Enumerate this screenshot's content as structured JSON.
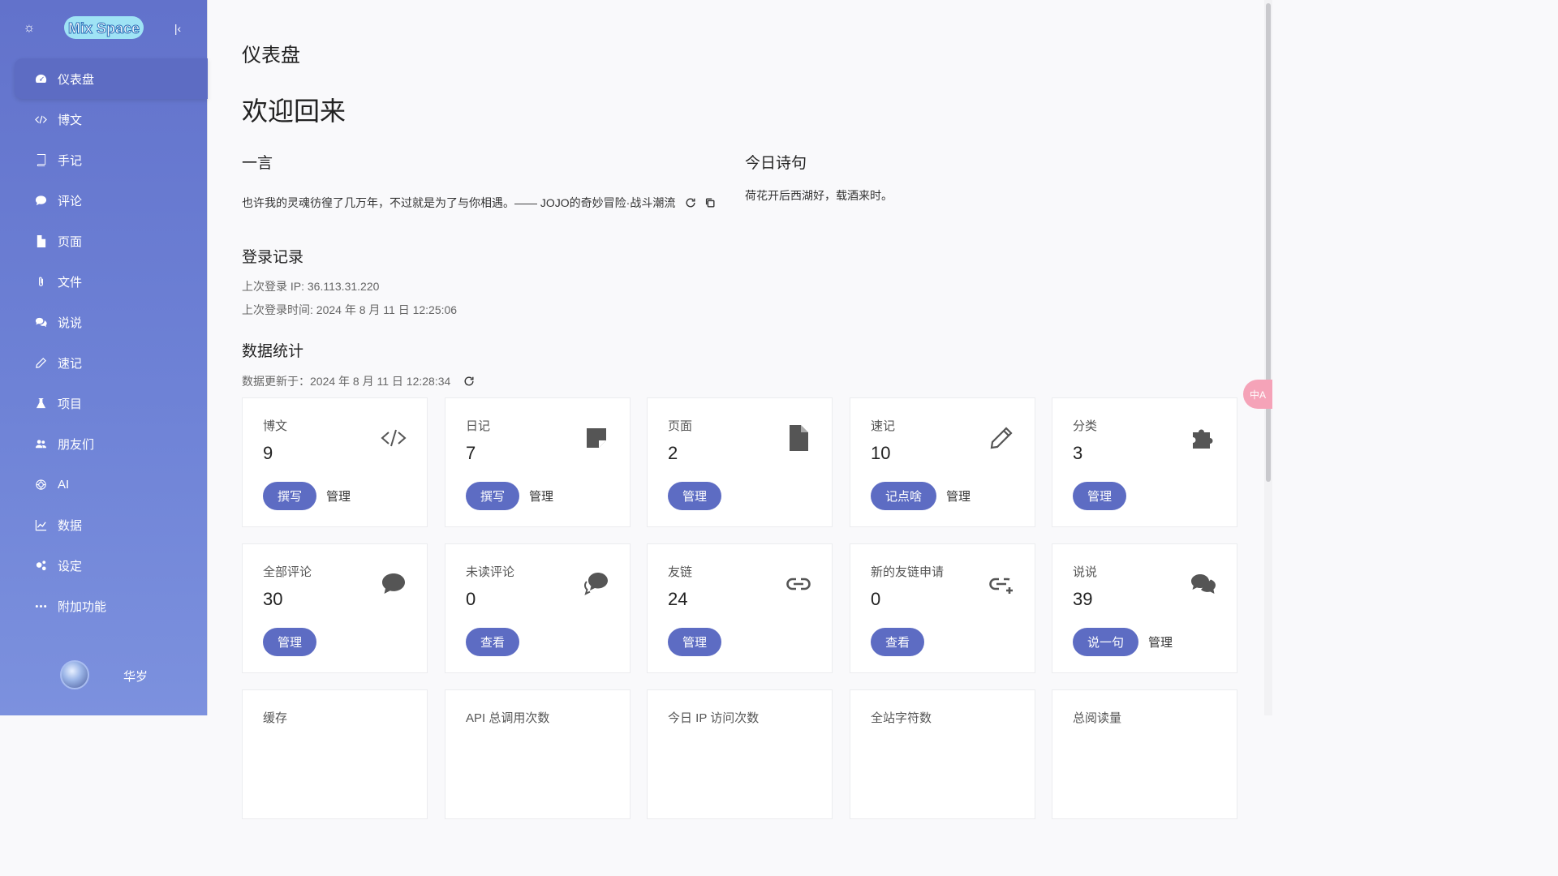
{
  "sidebar": {
    "logo_text": "Mix Space",
    "nav": [
      {
        "label": "仪表盘",
        "icon": "dashboard-icon",
        "active": true
      },
      {
        "label": "博文",
        "icon": "code-icon"
      },
      {
        "label": "手记",
        "icon": "book-icon"
      },
      {
        "label": "评论",
        "icon": "comment-icon"
      },
      {
        "label": "页面",
        "icon": "file-icon"
      },
      {
        "label": "文件",
        "icon": "paperclip-icon"
      },
      {
        "label": "说说",
        "icon": "chat-icon"
      },
      {
        "label": "速记",
        "icon": "pencil-icon"
      },
      {
        "label": "项目",
        "icon": "flask-icon"
      },
      {
        "label": "朋友们",
        "icon": "users-icon"
      },
      {
        "label": "AI",
        "icon": "ai-icon"
      },
      {
        "label": "数据",
        "icon": "chart-icon"
      },
      {
        "label": "设定",
        "icon": "gears-icon"
      },
      {
        "label": "附加功能",
        "icon": "ellipsis-icon"
      }
    ],
    "user": {
      "name": "华岁"
    }
  },
  "main": {
    "page_title": "仪表盘",
    "welcome": "欢迎回来",
    "hitokoto": {
      "title": "一言",
      "text": "也许我的灵魂彷徨了几万年，不过就是为了与你相遇。—— JOJO的奇妙冒险·战斗潮流"
    },
    "poem": {
      "title": "今日诗句",
      "text": "荷花开后西湖好，载酒来时。"
    },
    "login": {
      "title": "登录记录",
      "ip": "上次登录 IP: 36.113.31.220",
      "time": "上次登录时间: 2024 年 8 月 11 日 12:25:06"
    },
    "stats": {
      "title": "数据统计",
      "updated": "数据更新于：2024 年 8 月 11 日 12:28:34",
      "cards": [
        {
          "label": "博文",
          "value": "9",
          "icon": "code-icon",
          "primary": "撰写",
          "secondary": "管理"
        },
        {
          "label": "日记",
          "value": "7",
          "icon": "sticky-note-icon",
          "primary": "撰写",
          "secondary": "管理"
        },
        {
          "label": "页面",
          "value": "2",
          "icon": "file-icon",
          "primary": "管理",
          "secondary": ""
        },
        {
          "label": "速记",
          "value": "10",
          "icon": "pencil-icon",
          "primary": "记点啥",
          "secondary": "管理"
        },
        {
          "label": "分类",
          "value": "3",
          "icon": "puzzle-icon",
          "primary": "管理",
          "secondary": ""
        },
        {
          "label": "全部评论",
          "value": "30",
          "icon": "comment-icon",
          "primary": "管理",
          "secondary": ""
        },
        {
          "label": "未读评论",
          "value": "0",
          "icon": "comments-icon",
          "primary": "查看",
          "secondary": ""
        },
        {
          "label": "友链",
          "value": "24",
          "icon": "link-icon",
          "primary": "管理",
          "secondary": ""
        },
        {
          "label": "新的友链申请",
          "value": "0",
          "icon": "link-add-icon",
          "primary": "查看",
          "secondary": ""
        },
        {
          "label": "说说",
          "value": "39",
          "icon": "chat-icon",
          "primary": "说一句",
          "secondary": "管理"
        },
        {
          "label": "缓存",
          "value": "",
          "icon": "",
          "primary": "",
          "secondary": ""
        },
        {
          "label": "API 总调用次数",
          "value": "",
          "icon": "",
          "primary": "",
          "secondary": ""
        },
        {
          "label": "今日 IP 访问次数",
          "value": "",
          "icon": "",
          "primary": "",
          "secondary": ""
        },
        {
          "label": "全站字符数",
          "value": "",
          "icon": "",
          "primary": "",
          "secondary": ""
        },
        {
          "label": "总阅读量",
          "value": "",
          "icon": "",
          "primary": "",
          "secondary": ""
        }
      ]
    }
  },
  "floating": {
    "translate_label": "中A"
  },
  "colors": {
    "accent": "#5d6cc3",
    "sidebar_top": "#6272cb",
    "sidebar_bottom": "#7c91de"
  }
}
